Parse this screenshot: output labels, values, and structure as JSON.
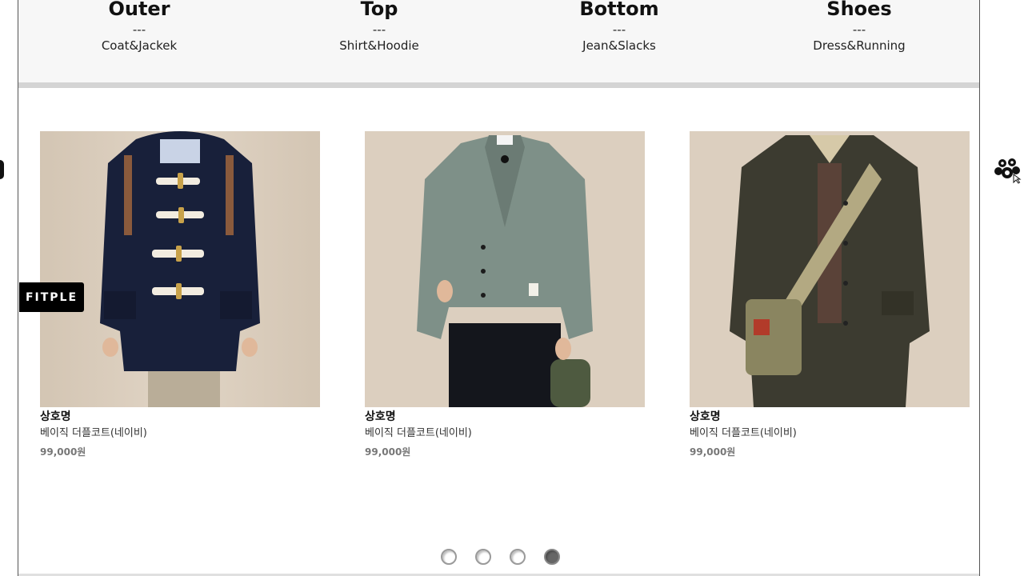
{
  "categories": [
    {
      "title": "Outer",
      "dash": "---",
      "sub": "Coat&Jackek"
    },
    {
      "title": "Top",
      "dash": "---",
      "sub": "Shirt&Hoodie"
    },
    {
      "title": "Bottom",
      "dash": "---",
      "sub": "Jean&Slacks"
    },
    {
      "title": "Shoes",
      "dash": "---",
      "sub": "Dress&Running"
    }
  ],
  "products": [
    {
      "shop": "상호명",
      "name": "베이직 더플코트(네이비)",
      "price": "99,000원"
    },
    {
      "shop": "상호명",
      "name": "베이직 더플코트(네이비)",
      "price": "99,000원"
    },
    {
      "shop": "상호명",
      "name": "베이직 더플코트(네이비)",
      "price": "99,000원"
    }
  ],
  "badge": {
    "label": "FITPLE"
  },
  "pager": {
    "count": 4,
    "active_index": 3
  },
  "colors": {
    "photo_background": "#dccfbf",
    "category_bar": "#f7f7f7",
    "badge": "#000000"
  },
  "icons": {
    "floating": "paw-icon"
  }
}
